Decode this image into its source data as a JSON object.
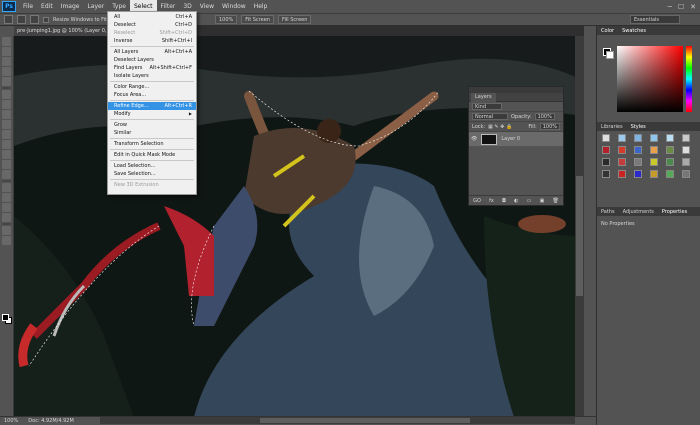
{
  "app": {
    "logo": "Ps"
  },
  "menu": [
    "File",
    "Edit",
    "Image",
    "Layer",
    "Type",
    "Select",
    "Filter",
    "3D",
    "View",
    "Window",
    "Help"
  ],
  "window_controls": [
    "─",
    "☐",
    "✕"
  ],
  "options": {
    "resize_label": "Resize Windows to Fit",
    "zoom_pct": "100%",
    "fit_screen": "Fit Screen",
    "fill_screen": "Fill Screen",
    "workspace": "Essentials"
  },
  "doc_tab": {
    "title": "pre-Jumping1.jpg @ 100% (Layer 0, RGB/8)",
    "close": "×"
  },
  "select_menu": {
    "items": [
      {
        "label": "All",
        "shortcut": "Ctrl+A"
      },
      {
        "label": "Deselect",
        "shortcut": "Ctrl+D"
      },
      {
        "label": "Reselect",
        "shortcut": "Shift+Ctrl+D",
        "disabled": true
      },
      {
        "label": "Inverse",
        "shortcut": "Shift+Ctrl+I"
      },
      {
        "sep": true
      },
      {
        "label": "All Layers",
        "shortcut": "Alt+Ctrl+A"
      },
      {
        "label": "Deselect Layers",
        "shortcut": ""
      },
      {
        "label": "Find Layers",
        "shortcut": "Alt+Shift+Ctrl+F"
      },
      {
        "label": "Isolate Layers",
        "shortcut": ""
      },
      {
        "sep": true
      },
      {
        "label": "Color Range...",
        "shortcut": ""
      },
      {
        "label": "Focus Area...",
        "shortcut": ""
      },
      {
        "sep": true
      },
      {
        "label": "Refine Edge...",
        "shortcut": "Alt+Ctrl+R",
        "highlight": true
      },
      {
        "label": "Modify",
        "shortcut": "▶",
        "arrow": true
      },
      {
        "sep": true
      },
      {
        "label": "Grow",
        "shortcut": ""
      },
      {
        "label": "Similar",
        "shortcut": ""
      },
      {
        "sep": true
      },
      {
        "label": "Transform Selection",
        "shortcut": ""
      },
      {
        "sep": true
      },
      {
        "label": "Edit in Quick Mask Mode",
        "shortcut": ""
      },
      {
        "sep": true
      },
      {
        "label": "Load Selection...",
        "shortcut": ""
      },
      {
        "label": "Save Selection...",
        "shortcut": ""
      },
      {
        "sep": true
      },
      {
        "label": "New 3D Extrusion",
        "shortcut": "",
        "disabled": true
      }
    ]
  },
  "layers_panel": {
    "tab": "Layers",
    "kind": "Kind",
    "blend": "Normal",
    "opacity_label": "Opacity:",
    "opacity": "100%",
    "lock_label": "Lock:",
    "fill_label": "Fill:",
    "fill": "100%",
    "layer_name": "Layer 0",
    "footer_icons": [
      "GO",
      "fx",
      "◘",
      "◐",
      "▭",
      "▣",
      "🗑"
    ]
  },
  "right_panel": {
    "color_tabs": [
      "Color",
      "Swatches"
    ],
    "lib_tabs": [
      "Libraries",
      "Styles"
    ],
    "prop_tabs": [
      "Paths",
      "Adjustments",
      "Properties"
    ],
    "no_properties": "No Properties"
  },
  "status": {
    "zoom": "100%",
    "doc": "Doc: 4.92M/4.92M"
  },
  "colors": {
    "highlight": "#3593e6",
    "ui": "#535353"
  }
}
